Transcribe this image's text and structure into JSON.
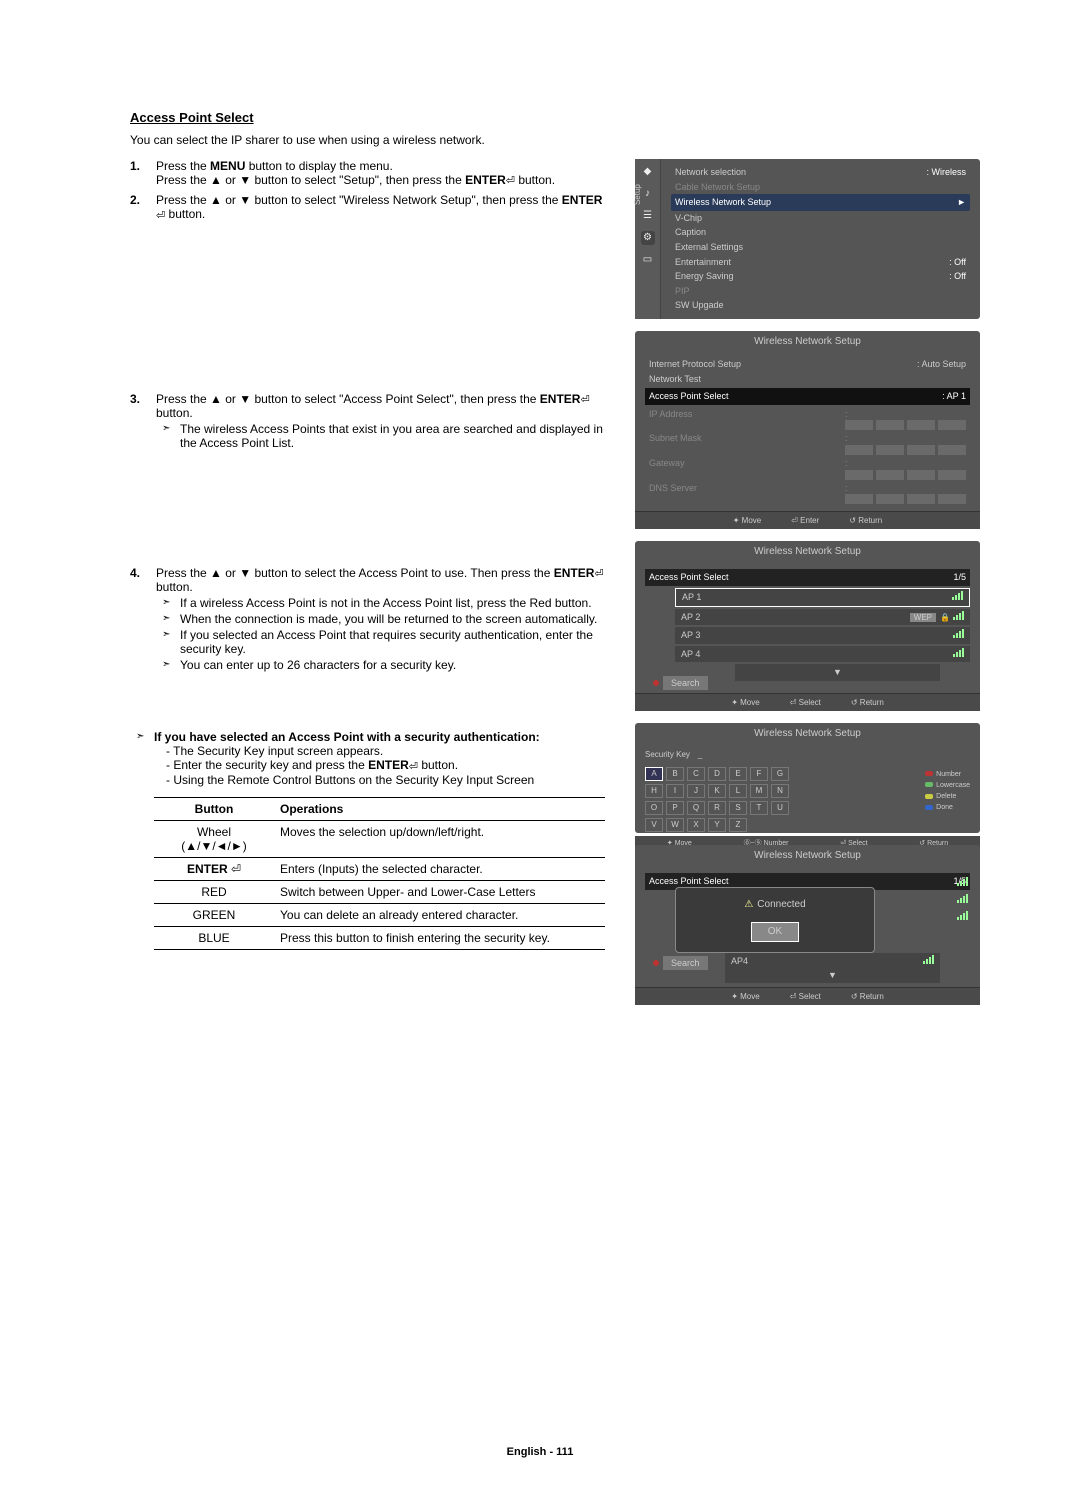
{
  "section_title": "Access Point Select",
  "intro": "You can select the IP sharer to use when using a wireless network.",
  "steps": {
    "s1": {
      "num": "1.",
      "line1_a": "Press the ",
      "menu_word": "MENU",
      "line1_b": " button to display the menu.",
      "line2_a": "Press the ▲ or ▼ button to select \"Setup\", then press the ",
      "enter_word": "ENTER",
      "line2_b": " button."
    },
    "s2": {
      "num": "2.",
      "line_a": "Press the ▲ or ▼ button to select \"Wireless Network Setup\", then press the ",
      "enter_word": "ENTER",
      "line_b": " button."
    },
    "s3": {
      "num": "3.",
      "line_a": "Press the ▲ or ▼ button to select \"Access Point Select\", then press the ",
      "enter_word": "ENTER",
      "line_b": " button.",
      "sub1": "The wireless Access Points that exist in you area are searched and displayed in the Access Point List."
    },
    "s4": {
      "num": "4.",
      "line_a": "Press the ▲ or ▼ button to select the Access Point to use. Then press the ",
      "enter_word": "ENTER",
      "line_b": " button.",
      "sub1": "If a wireless Access Point is not in the Access Point list, press the Red button.",
      "sub2": "When the connection is made, you will be returned to the screen automatically.",
      "sub3": "If you selected an Access Point that requires security authentication, enter the security key.",
      "sub4": "You can enter up to 26 characters for a security key."
    },
    "auth": {
      "title": "If you have selected an Access Point with a security authentication:",
      "a": "- The Security Key input screen appears.",
      "b_pre": "- Enter the security key and press the ",
      "enter_word": "ENTER",
      "b_post": " button.",
      "c": "- Using the Remote Control Buttons on the Security Key Input Screen"
    }
  },
  "table": {
    "head_button": "Button",
    "head_ops": "Operations",
    "rows": [
      {
        "btn": "Wheel\n(▲/▼/◄/►)",
        "op": "Moves the selection up/down/left/right."
      },
      {
        "btn": "ENTER ⏎",
        "op": "Enters (Inputs) the selected character."
      },
      {
        "btn": "RED",
        "op": "Switch between Upper- and Lower-Case Letters"
      },
      {
        "btn": "GREEN",
        "op": "You can delete an already entered character."
      },
      {
        "btn": "BLUE",
        "op": "Press this button to finish entering the security key."
      }
    ]
  },
  "osd_setup": {
    "items": [
      {
        "label": "Network selection",
        "value": ": Wireless"
      },
      {
        "label": "Cable Network Setup",
        "value": "",
        "dim": true
      },
      {
        "label": "Wireless Network Setup",
        "value": "►",
        "hl": true
      },
      {
        "label": "V-Chip",
        "value": ""
      },
      {
        "label": "Caption",
        "value": ""
      },
      {
        "label": "External Settings",
        "value": ""
      },
      {
        "label": "Entertainment",
        "value": ": Off"
      },
      {
        "label": "Energy Saving",
        "value": ": Off"
      },
      {
        "label": "PIP",
        "value": "",
        "dim": true
      },
      {
        "label": "SW Upgade",
        "value": ""
      }
    ]
  },
  "osd_wns": {
    "title": "Wireless Network Setup",
    "rows": [
      {
        "label": "Internet Protocol Setup",
        "value": ": Auto Setup"
      },
      {
        "label": "Network Test",
        "value": ""
      }
    ],
    "ap_label": "Access Point Select",
    "ap_value": ": AP 1",
    "dim_rows": [
      "IP Address",
      "Subnet Mask",
      "Gateway",
      "DNS Server"
    ],
    "foot": {
      "move": "Move",
      "enter": "Enter",
      "return": "Return"
    }
  },
  "osd_aps": {
    "title": "Wireless Network Setup",
    "header_label": "Access Point Select",
    "counter": "1/5",
    "items": [
      {
        "name": "AP 1",
        "wep": false,
        "hl": true
      },
      {
        "name": "AP 2",
        "wep": true
      },
      {
        "name": "AP 3",
        "wep": false
      },
      {
        "name": "AP 4",
        "wep": false
      }
    ],
    "search": "Search",
    "foot": {
      "move": "Move",
      "select": "Select",
      "return": "Return"
    }
  },
  "osd_key": {
    "title": "Wireless Network Setup",
    "field_label": "Security Key",
    "field_value": "_",
    "keys": [
      "A",
      "B",
      "C",
      "D",
      "E",
      "F",
      "G",
      "H",
      "I",
      "J",
      "K",
      "L",
      "M",
      "N",
      "O",
      "P",
      "Q",
      "R",
      "S",
      "T",
      "U",
      "V",
      "W",
      "X",
      "Y",
      "Z"
    ],
    "legend": [
      {
        "color": "#b33",
        "label": "Number"
      },
      {
        "color": "#6b6",
        "label": "Lowercase"
      },
      {
        "color": "#cc4",
        "label": "Delete"
      },
      {
        "color": "#36c",
        "label": "Done"
      }
    ],
    "foot": [
      "Move",
      "Number",
      "Select",
      "Return"
    ]
  },
  "osd_conn": {
    "title": "Wireless Network Setup",
    "header_label": "Access Point Select",
    "counter": "1/5",
    "popup_text": "Connected",
    "ok": "OK",
    "ap4": "AP4",
    "search": "Search",
    "foot": {
      "move": "Move",
      "select": "Select",
      "return": "Return"
    }
  },
  "footer": "English - 111"
}
